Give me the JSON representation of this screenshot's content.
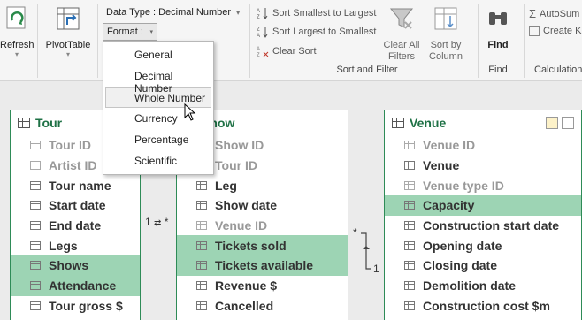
{
  "ribbon": {
    "refresh_label": "Refresh",
    "pivottable_label": "PivotTable",
    "data_type_label": "Data Type : Decimal Number",
    "format_label": "Format :",
    "sort_smallest": "Sort Smallest to Largest",
    "sort_largest": "Sort Largest to Smallest",
    "clear_sort": "Clear Sort",
    "clear_all_filters": "Clear All\nFilters",
    "sort_by_column": "Sort by\nColumn",
    "sort_filter_group": "Sort and Filter",
    "find_label": "Find",
    "find_group": "Find",
    "autosum": "AutoSum",
    "create_kpi": "Create K",
    "calculations_group": "Calculation"
  },
  "format_menu": {
    "items": [
      "General",
      "Decimal Number",
      "Whole Number",
      "Currency",
      "Percentage",
      "Scientific"
    ],
    "hover_index": 2
  },
  "tables": [
    {
      "name": "Tour",
      "fields": [
        {
          "label": "Tour ID",
          "dim": true,
          "selected": false
        },
        {
          "label": "Artist ID",
          "dim": true,
          "selected": false
        },
        {
          "label": "Tour name",
          "dim": false,
          "selected": false
        },
        {
          "label": "Start date",
          "dim": false,
          "selected": false
        },
        {
          "label": "End date",
          "dim": false,
          "selected": false
        },
        {
          "label": "Legs",
          "dim": false,
          "selected": false
        },
        {
          "label": "Shows",
          "dim": false,
          "selected": true
        },
        {
          "label": "Attendance",
          "dim": false,
          "selected": true
        },
        {
          "label": "Tour gross $",
          "dim": false,
          "selected": false
        }
      ]
    },
    {
      "name": "Show",
      "fields": [
        {
          "label": "Show ID",
          "dim": true,
          "selected": false
        },
        {
          "label": "Tour ID",
          "dim": true,
          "selected": false
        },
        {
          "label": "Leg",
          "dim": false,
          "selected": false
        },
        {
          "label": "Show date",
          "dim": false,
          "selected": false
        },
        {
          "label": "Venue ID",
          "dim": true,
          "selected": false
        },
        {
          "label": "Tickets sold",
          "dim": false,
          "selected": true
        },
        {
          "label": "Tickets available",
          "dim": false,
          "selected": true
        },
        {
          "label": "Revenue $",
          "dim": false,
          "selected": false
        },
        {
          "label": "Cancelled",
          "dim": false,
          "selected": false
        }
      ]
    },
    {
      "name": "Venue",
      "fields": [
        {
          "label": "Venue ID",
          "dim": true,
          "selected": false
        },
        {
          "label": "Venue",
          "dim": false,
          "selected": false
        },
        {
          "label": "Venue type ID",
          "dim": true,
          "selected": false
        },
        {
          "label": "Capacity",
          "dim": false,
          "selected": true
        },
        {
          "label": "Construction start date",
          "dim": false,
          "selected": false
        },
        {
          "label": "Opening date",
          "dim": false,
          "selected": false
        },
        {
          "label": "Closing date",
          "dim": false,
          "selected": false
        },
        {
          "label": "Demolition date",
          "dim": false,
          "selected": false
        },
        {
          "label": "Construction cost $m",
          "dim": false,
          "selected": false
        }
      ]
    }
  ],
  "relationships": {
    "tour_show_one": "1",
    "tour_show_many": "*",
    "show_venue_many": "*",
    "show_venue_one": "1"
  },
  "colors": {
    "accent": "#1e7145",
    "selected_row": "#9dd4b4",
    "canvas": "#ebebeb"
  }
}
